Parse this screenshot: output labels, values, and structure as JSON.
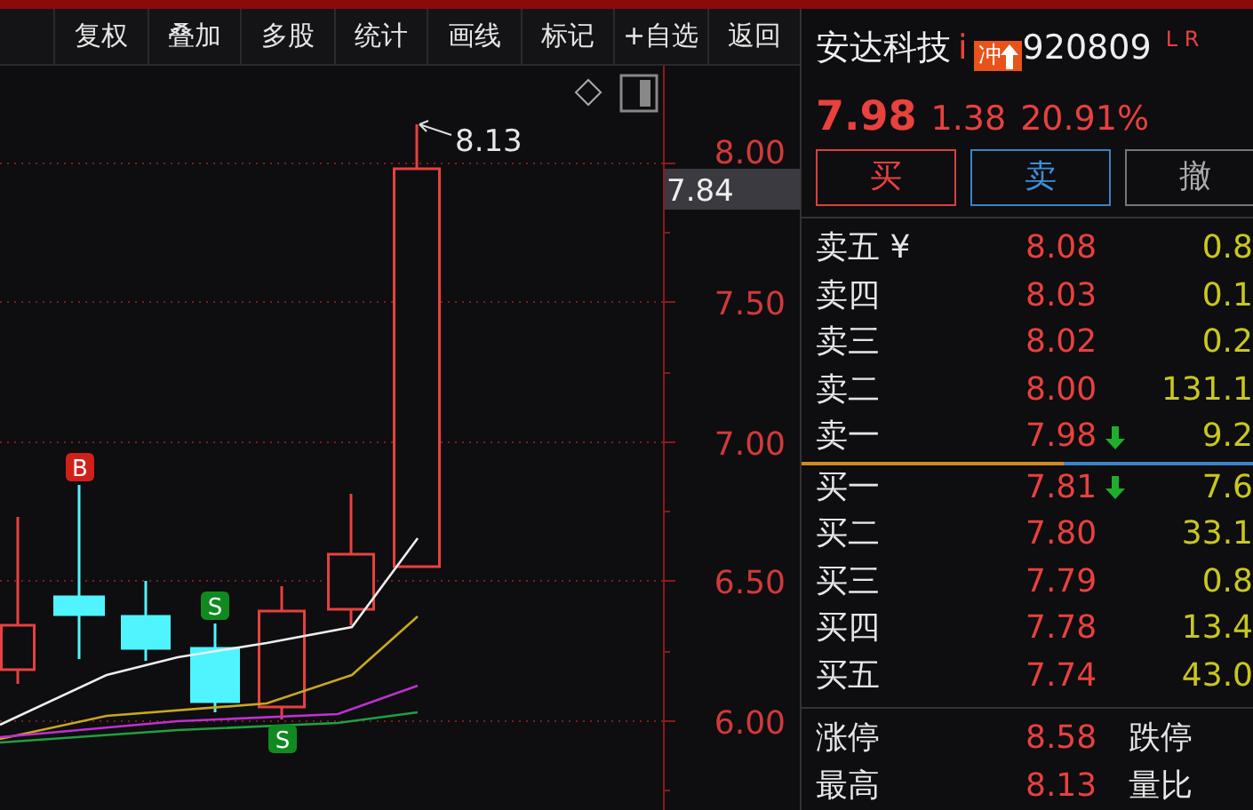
{
  "toolbar": {
    "buttons": [
      "复权",
      "叠加",
      "多股",
      "统计",
      "画线",
      "标记",
      "+自选",
      "返回"
    ]
  },
  "chart": {
    "y_axis_labels": [
      "8.00",
      "7.50",
      "7.00",
      "6.50",
      "6.00"
    ],
    "high_label": "8.13",
    "current_price_label": "7.84",
    "signals": [
      {
        "kind": "buy",
        "text": "B"
      },
      {
        "kind": "sell",
        "text": "S"
      },
      {
        "kind": "sell",
        "text": "S"
      }
    ]
  },
  "quote": {
    "name": "安达科技",
    "info_mark": "i",
    "limit_badge": "冲",
    "code": "920809",
    "flags": "L R",
    "price": "7.98",
    "change": "1.38",
    "change_pct": "20.91%"
  },
  "trade_buttons": [
    {
      "label": "买",
      "kind": "buy"
    },
    {
      "label": "卖",
      "kind": "sell"
    },
    {
      "label": "撤",
      "kind": "cancel"
    }
  ],
  "asks": [
    {
      "label": "卖五 ¥",
      "price": "8.08",
      "volume": "0.8",
      "falling": false
    },
    {
      "label": "卖四",
      "price": "8.03",
      "volume": "0.1",
      "falling": false
    },
    {
      "label": "卖三",
      "price": "8.02",
      "volume": "0.2",
      "falling": false
    },
    {
      "label": "卖二",
      "price": "8.00",
      "volume": "131.1",
      "falling": false
    },
    {
      "label": "卖一",
      "price": "7.98",
      "volume": "9.2",
      "falling": true
    }
  ],
  "bids": [
    {
      "label": "买一",
      "price": "7.81",
      "volume": "7.6",
      "falling": true
    },
    {
      "label": "买二",
      "price": "7.80",
      "volume": "33.1",
      "falling": false
    },
    {
      "label": "买三",
      "price": "7.79",
      "volume": "0.8",
      "falling": false
    },
    {
      "label": "买四",
      "price": "7.78",
      "volume": "13.4",
      "falling": false
    },
    {
      "label": "买五",
      "price": "7.74",
      "volume": "43.0",
      "falling": false
    }
  ],
  "stats": [
    {
      "label": "涨停",
      "value": "8.58",
      "label_2": "跌停"
    },
    {
      "label": "最高",
      "value": "8.13",
      "label_2": "量比"
    }
  ]
}
